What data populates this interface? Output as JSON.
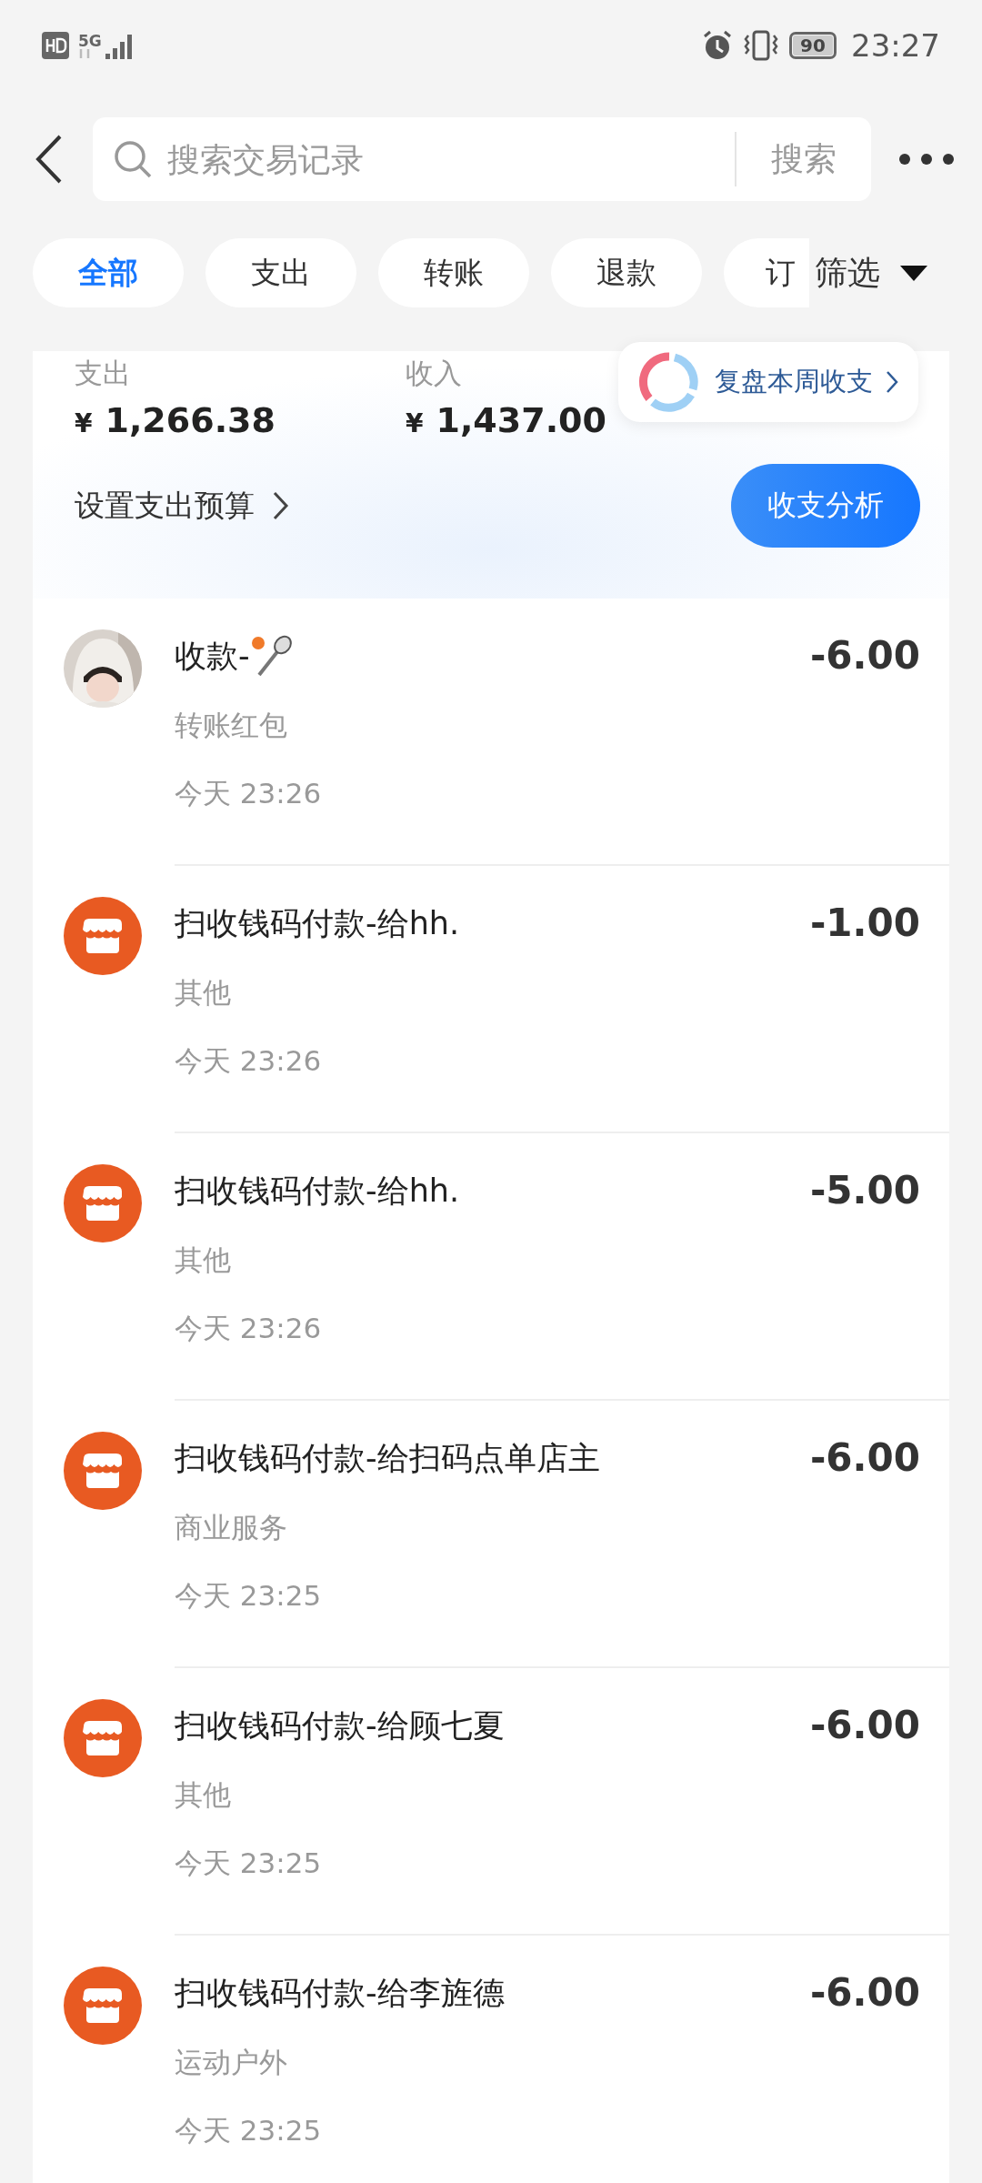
{
  "status_bar": {
    "network": "5G",
    "battery": "90",
    "time": "23:27"
  },
  "header": {
    "search": {
      "placeholder": "搜索交易记录",
      "button": "搜索"
    }
  },
  "tabs": [
    {
      "label": "全部",
      "selected": true
    },
    {
      "label": "支出",
      "selected": false
    },
    {
      "label": "转账",
      "selected": false
    },
    {
      "label": "退款",
      "selected": false
    },
    {
      "label": "订",
      "selected": false
    }
  ],
  "filter": {
    "label": "筛选"
  },
  "summary": {
    "stats": [
      {
        "label": "支出",
        "currency": "¥",
        "amount": "1,266.38"
      },
      {
        "label": "收入",
        "currency": "¥",
        "amount": "1,437.00"
      }
    ],
    "review_tip": "复盘本周收支",
    "budget_link": "设置支出预算",
    "analysis_button": "收支分析"
  },
  "transactions": [
    {
      "kind": "avatar",
      "title": "收款-",
      "sticker": true,
      "category": "转账红包",
      "time": "今天 23:26",
      "amount": "-6.00"
    },
    {
      "kind": "shop",
      "title": "扫收钱码付款-给hh.",
      "category": "其他",
      "time": "今天 23:26",
      "amount": "-1.00"
    },
    {
      "kind": "shop",
      "title": "扫收钱码付款-给hh.",
      "category": "其他",
      "time": "今天 23:26",
      "amount": "-5.00"
    },
    {
      "kind": "shop",
      "title": "扫收钱码付款-给扫码点单店主",
      "category": "商业服务",
      "time": "今天 23:25",
      "amount": "-6.00"
    },
    {
      "kind": "shop",
      "title": "扫收钱码付款-给顾七夏",
      "category": "其他",
      "time": "今天 23:25",
      "amount": "-6.00"
    },
    {
      "kind": "shop",
      "title": "扫收钱码付款-给李旌德",
      "category": "运动户外",
      "time": "今天 23:25",
      "amount": "-6.00"
    }
  ]
}
